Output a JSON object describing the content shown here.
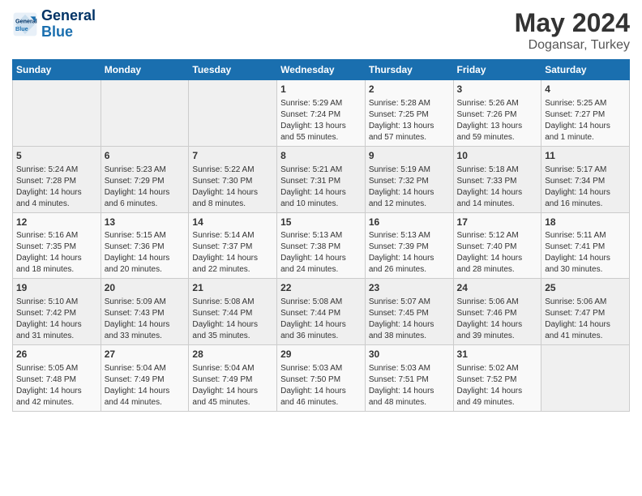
{
  "header": {
    "logo_line1": "General",
    "logo_line2": "Blue",
    "month_year": "May 2024",
    "location": "Dogansar, Turkey"
  },
  "weekdays": [
    "Sunday",
    "Monday",
    "Tuesday",
    "Wednesday",
    "Thursday",
    "Friday",
    "Saturday"
  ],
  "weeks": [
    [
      {
        "day": "",
        "info": ""
      },
      {
        "day": "",
        "info": ""
      },
      {
        "day": "",
        "info": ""
      },
      {
        "day": "1",
        "info": "Sunrise: 5:29 AM\nSunset: 7:24 PM\nDaylight: 13 hours and 55 minutes."
      },
      {
        "day": "2",
        "info": "Sunrise: 5:28 AM\nSunset: 7:25 PM\nDaylight: 13 hours and 57 minutes."
      },
      {
        "day": "3",
        "info": "Sunrise: 5:26 AM\nSunset: 7:26 PM\nDaylight: 13 hours and 59 minutes."
      },
      {
        "day": "4",
        "info": "Sunrise: 5:25 AM\nSunset: 7:27 PM\nDaylight: 14 hours and 1 minute."
      }
    ],
    [
      {
        "day": "5",
        "info": "Sunrise: 5:24 AM\nSunset: 7:28 PM\nDaylight: 14 hours and 4 minutes."
      },
      {
        "day": "6",
        "info": "Sunrise: 5:23 AM\nSunset: 7:29 PM\nDaylight: 14 hours and 6 minutes."
      },
      {
        "day": "7",
        "info": "Sunrise: 5:22 AM\nSunset: 7:30 PM\nDaylight: 14 hours and 8 minutes."
      },
      {
        "day": "8",
        "info": "Sunrise: 5:21 AM\nSunset: 7:31 PM\nDaylight: 14 hours and 10 minutes."
      },
      {
        "day": "9",
        "info": "Sunrise: 5:19 AM\nSunset: 7:32 PM\nDaylight: 14 hours and 12 minutes."
      },
      {
        "day": "10",
        "info": "Sunrise: 5:18 AM\nSunset: 7:33 PM\nDaylight: 14 hours and 14 minutes."
      },
      {
        "day": "11",
        "info": "Sunrise: 5:17 AM\nSunset: 7:34 PM\nDaylight: 14 hours and 16 minutes."
      }
    ],
    [
      {
        "day": "12",
        "info": "Sunrise: 5:16 AM\nSunset: 7:35 PM\nDaylight: 14 hours and 18 minutes."
      },
      {
        "day": "13",
        "info": "Sunrise: 5:15 AM\nSunset: 7:36 PM\nDaylight: 14 hours and 20 minutes."
      },
      {
        "day": "14",
        "info": "Sunrise: 5:14 AM\nSunset: 7:37 PM\nDaylight: 14 hours and 22 minutes."
      },
      {
        "day": "15",
        "info": "Sunrise: 5:13 AM\nSunset: 7:38 PM\nDaylight: 14 hours and 24 minutes."
      },
      {
        "day": "16",
        "info": "Sunrise: 5:13 AM\nSunset: 7:39 PM\nDaylight: 14 hours and 26 minutes."
      },
      {
        "day": "17",
        "info": "Sunrise: 5:12 AM\nSunset: 7:40 PM\nDaylight: 14 hours and 28 minutes."
      },
      {
        "day": "18",
        "info": "Sunrise: 5:11 AM\nSunset: 7:41 PM\nDaylight: 14 hours and 30 minutes."
      }
    ],
    [
      {
        "day": "19",
        "info": "Sunrise: 5:10 AM\nSunset: 7:42 PM\nDaylight: 14 hours and 31 minutes."
      },
      {
        "day": "20",
        "info": "Sunrise: 5:09 AM\nSunset: 7:43 PM\nDaylight: 14 hours and 33 minutes."
      },
      {
        "day": "21",
        "info": "Sunrise: 5:08 AM\nSunset: 7:44 PM\nDaylight: 14 hours and 35 minutes."
      },
      {
        "day": "22",
        "info": "Sunrise: 5:08 AM\nSunset: 7:44 PM\nDaylight: 14 hours and 36 minutes."
      },
      {
        "day": "23",
        "info": "Sunrise: 5:07 AM\nSunset: 7:45 PM\nDaylight: 14 hours and 38 minutes."
      },
      {
        "day": "24",
        "info": "Sunrise: 5:06 AM\nSunset: 7:46 PM\nDaylight: 14 hours and 39 minutes."
      },
      {
        "day": "25",
        "info": "Sunrise: 5:06 AM\nSunset: 7:47 PM\nDaylight: 14 hours and 41 minutes."
      }
    ],
    [
      {
        "day": "26",
        "info": "Sunrise: 5:05 AM\nSunset: 7:48 PM\nDaylight: 14 hours and 42 minutes."
      },
      {
        "day": "27",
        "info": "Sunrise: 5:04 AM\nSunset: 7:49 PM\nDaylight: 14 hours and 44 minutes."
      },
      {
        "day": "28",
        "info": "Sunrise: 5:04 AM\nSunset: 7:49 PM\nDaylight: 14 hours and 45 minutes."
      },
      {
        "day": "29",
        "info": "Sunrise: 5:03 AM\nSunset: 7:50 PM\nDaylight: 14 hours and 46 minutes."
      },
      {
        "day": "30",
        "info": "Sunrise: 5:03 AM\nSunset: 7:51 PM\nDaylight: 14 hours and 48 minutes."
      },
      {
        "day": "31",
        "info": "Sunrise: 5:02 AM\nSunset: 7:52 PM\nDaylight: 14 hours and 49 minutes."
      },
      {
        "day": "",
        "info": ""
      }
    ]
  ]
}
